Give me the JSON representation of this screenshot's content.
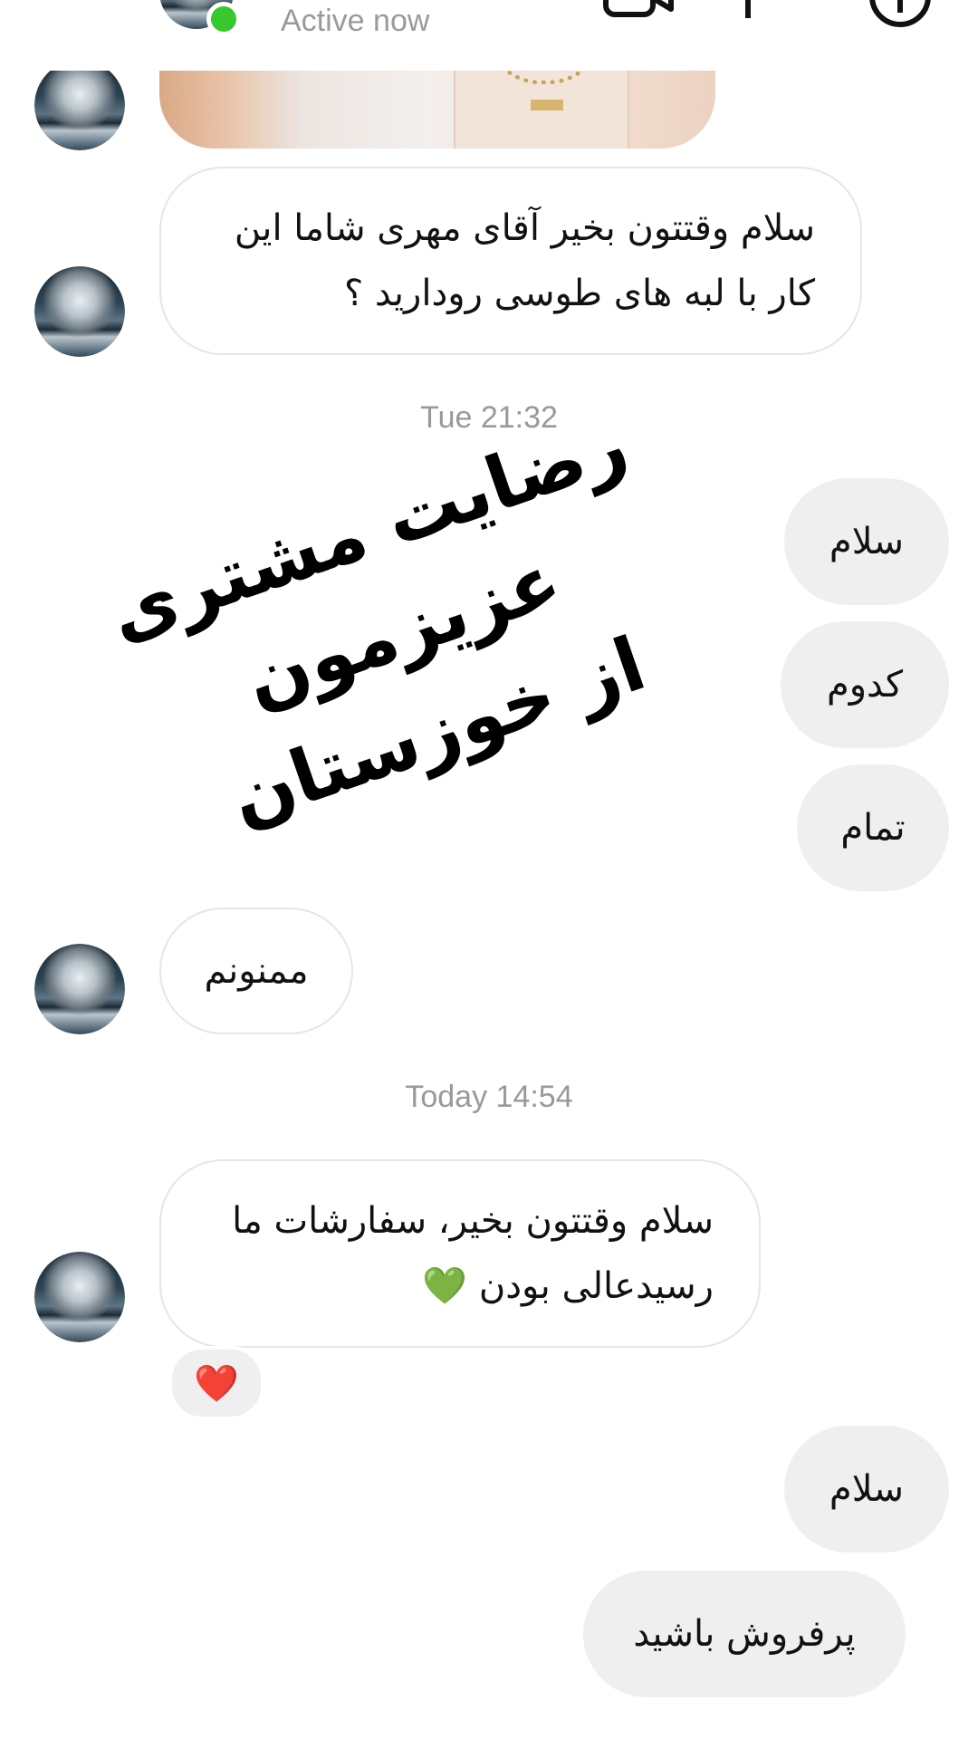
{
  "header": {
    "status": "Active now",
    "icons": [
      "back-arrow-icon",
      "video-call-icon",
      "flag-icon",
      "info-icon"
    ]
  },
  "messages": {
    "m1": "سلام وقتتون بخیر آقای مهری شاما این کار با لبه های طوسی رودارید ؟",
    "m2": "سلام",
    "m3": "کدوم",
    "m4": "تمام",
    "m5": "ممنونم",
    "m6": "سلام وقتتون بخیر، سفارشات ما رسیدعالی بودن 💚",
    "m7": "سلام",
    "m8": "پرفروش باشید"
  },
  "timestamps": {
    "t1": "Tue 21:32",
    "t2": "Today 14:54"
  },
  "reaction": {
    "emoji": "❤️"
  },
  "overlay": {
    "line1": "رضایت مشتری عزیزمون",
    "line2": "از خوزستان"
  },
  "colors": {
    "online": "#37c82d",
    "incoming_border": "#e6e6e6",
    "outgoing_bg": "#efefef",
    "timestamp": "#999999"
  }
}
